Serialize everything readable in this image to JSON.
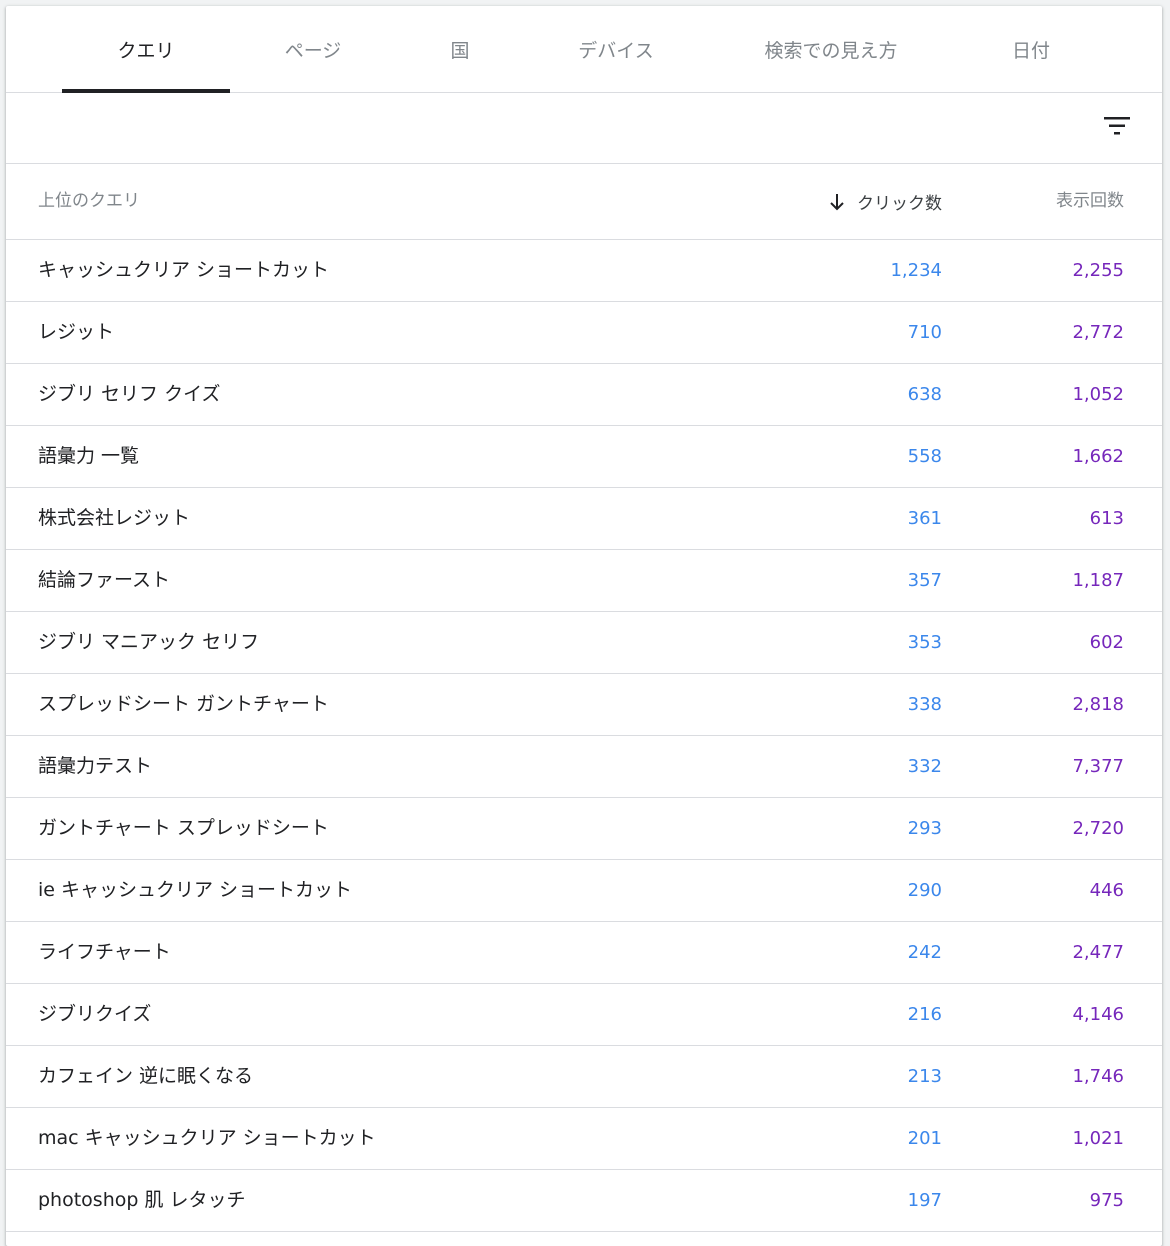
{
  "tabs": [
    {
      "label": "クエリ",
      "active": true
    },
    {
      "label": "ページ",
      "active": false
    },
    {
      "label": "国",
      "active": false
    },
    {
      "label": "デバイス",
      "active": false
    },
    {
      "label": "検索での見え方",
      "active": false
    },
    {
      "label": "日付",
      "active": false
    }
  ],
  "filter": {
    "icon": "filter-list-icon"
  },
  "table": {
    "headers": {
      "query": "上位のクエリ",
      "clicks": "クリック数",
      "impressions": "表示回数",
      "sort_icon": "arrow-down-icon"
    },
    "colors": {
      "clicks": "#1a73e8",
      "impressions": "#7627bb"
    },
    "rows": [
      {
        "query": "キャッシュクリア ショートカット",
        "clicks": "1,234",
        "impressions": "2,255"
      },
      {
        "query": "レジット",
        "clicks": "710",
        "impressions": "2,772"
      },
      {
        "query": "ジブリ セリフ クイズ",
        "clicks": "638",
        "impressions": "1,052"
      },
      {
        "query": "語彙力 一覧",
        "clicks": "558",
        "impressions": "1,662"
      },
      {
        "query": "株式会社レジット",
        "clicks": "361",
        "impressions": "613"
      },
      {
        "query": "結論ファースト",
        "clicks": "357",
        "impressions": "1,187"
      },
      {
        "query": "ジブリ マニアック セリフ",
        "clicks": "353",
        "impressions": "602"
      },
      {
        "query": "スプレッドシート ガントチャート",
        "clicks": "338",
        "impressions": "2,818"
      },
      {
        "query": "語彙力テスト",
        "clicks": "332",
        "impressions": "7,377"
      },
      {
        "query": "ガントチャート スプレッドシート",
        "clicks": "293",
        "impressions": "2,720"
      },
      {
        "query": "ie キャッシュクリア ショートカット",
        "clicks": "290",
        "impressions": "446"
      },
      {
        "query": "ライフチャート",
        "clicks": "242",
        "impressions": "2,477"
      },
      {
        "query": "ジブリクイズ",
        "clicks": "216",
        "impressions": "4,146"
      },
      {
        "query": "カフェイン 逆に眠くなる",
        "clicks": "213",
        "impressions": "1,746"
      },
      {
        "query": "mac キャッシュクリア ショートカット",
        "clicks": "201",
        "impressions": "1,021"
      },
      {
        "query": "photoshop 肌 レタッチ",
        "clicks": "197",
        "impressions": "975"
      }
    ]
  }
}
